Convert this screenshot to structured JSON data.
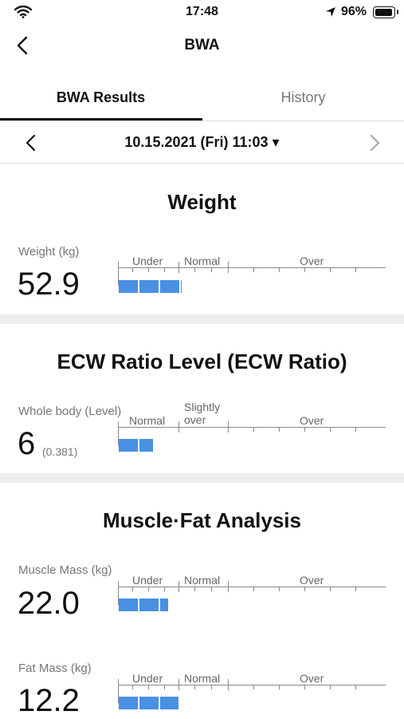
{
  "status_bar": {
    "time": "17:48",
    "battery": "96%"
  },
  "header": {
    "title": "BWA"
  },
  "tabs": [
    {
      "label": "BWA Results",
      "active": true
    },
    {
      "label": "History",
      "active": false
    }
  ],
  "date_selector": {
    "label": "10.15.2021 (Fri) 11:03 ▾"
  },
  "sections": {
    "weight": {
      "title": "Weight",
      "items": [
        {
          "label": "Weight (kg)",
          "value": "52.9",
          "zones": [
            "Under",
            "Normal",
            "Over"
          ]
        }
      ]
    },
    "ecw": {
      "title": "ECW Ratio Level (ECW Ratio)",
      "items": [
        {
          "label": "Whole body (Level)",
          "value": "6",
          "sub_value": "(0.381)",
          "zones": [
            "Normal",
            "Slightly over",
            "Over"
          ]
        }
      ]
    },
    "muscle_fat": {
      "title": "Muscle·Fat Analysis",
      "items": [
        {
          "label": "Muscle Mass (kg)",
          "value": "22.0",
          "zones": [
            "Under",
            "Normal",
            "Over"
          ]
        },
        {
          "label": "Fat Mass (kg)",
          "value": "12.2",
          "zones": [
            "Under",
            "Normal",
            "Over"
          ]
        }
      ]
    }
  },
  "colors": {
    "bar": "#4a90e2",
    "section_gap": "#eeeeee",
    "active_tab": "#111111",
    "inactive_tab": "#777777"
  }
}
